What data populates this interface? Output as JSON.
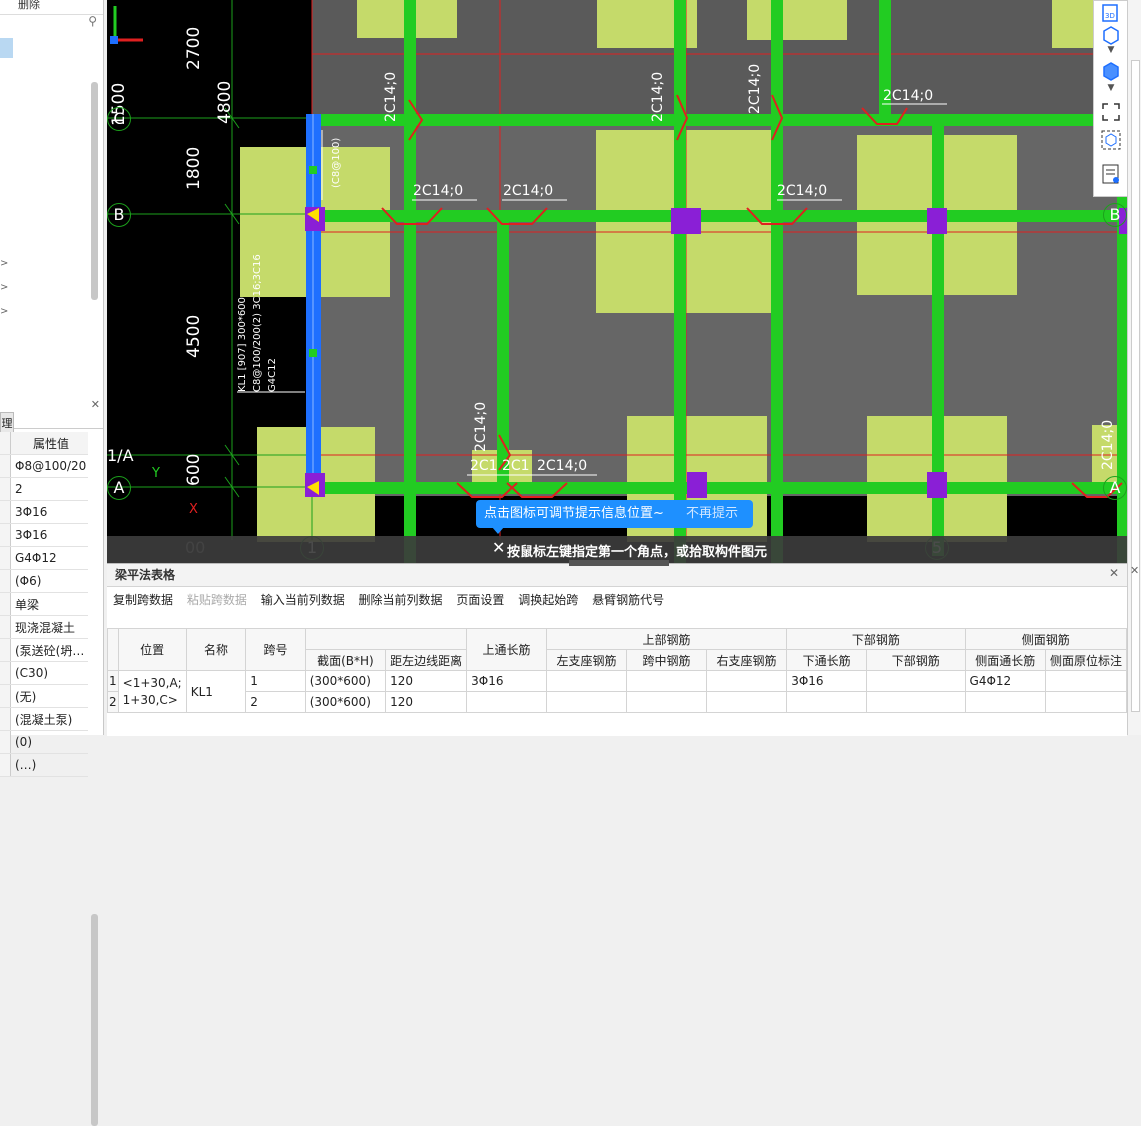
{
  "left_top": {
    "toolbar_label": "删除",
    "search_icon": "search-icon",
    "tree_arrows": [
      ">",
      ">",
      ">"
    ]
  },
  "left_bottom": {
    "tab_label": "理",
    "header": "属性值",
    "values": [
      "Φ8@100/20",
      "2",
      "3Φ16",
      "3Φ16",
      "G4Φ12",
      "(Φ6)",
      "单梁",
      "现浇混凝土",
      "(泵送砼(坍…",
      "(C30)",
      "(无)",
      "(混凝土泵)",
      "(0)",
      "(…)"
    ]
  },
  "canvas": {
    "dimensions": [
      "2700",
      "4800",
      "1500",
      "1800",
      "4500",
      "600"
    ],
    "axes": [
      "C",
      "B",
      "1/A",
      "A",
      "1",
      "5",
      "B",
      "A",
      "00",
      "("
    ],
    "beam_label": "KL1 [907] 300*600",
    "beam_label2": "C8@100/200(2) 3C16;3C16",
    "beam_label3": "G4C12",
    "beam_stirrup": "(C8@100)",
    "rebar_label": "2C14;0",
    "rebar_label_short": "2C1",
    "tip": {
      "message": "点击图标可调节提示信息位置~",
      "dismiss": "不再提示"
    },
    "status": "按鼠标左键指定第一个角点，或拾取构件图元",
    "ucs": {
      "x": "X",
      "y": "Y"
    }
  },
  "right_toolbar": {
    "icons": [
      "3d-view-icon",
      "cube-icon",
      "chevron-down-icon",
      "cube-solid-icon",
      "chevron-down-icon",
      "fit-view-icon",
      "view-cube-icon",
      "report-icon"
    ],
    "label_3d": "3D"
  },
  "bottom": {
    "title": "梁平法表格",
    "toolbar": [
      {
        "label": "复制跨数据",
        "disabled": false
      },
      {
        "label": "粘贴跨数据",
        "disabled": true
      },
      {
        "label": "输入当前列数据",
        "disabled": false
      },
      {
        "label": "删除当前列数据",
        "disabled": false
      },
      {
        "label": "页面设置",
        "disabled": false
      },
      {
        "label": "调换起始跨",
        "disabled": false
      },
      {
        "label": "悬臂钢筋代号",
        "disabled": false
      }
    ],
    "headers": {
      "position": "位置",
      "name": "名称",
      "span": "跨号",
      "section": "截面(B*H)",
      "offset": "距左边线距离",
      "top_through": "上通长筋",
      "top_group": "上部钢筋",
      "left_support": "左支座钢筋",
      "mid_span": "跨中钢筋",
      "right_support": "右支座钢筋",
      "bottom_group": "下部钢筋",
      "bottom_through": "下通长筋",
      "bottom_bar": "下部钢筋",
      "side_group": "侧面钢筋",
      "side_through": "侧面通长筋",
      "side_in_situ": "侧面原位标注"
    },
    "rows": [
      {
        "index": "1",
        "position": "<1+30,A;",
        "name": "KL1",
        "span": "1",
        "section": "(300*600)",
        "offset": "120",
        "top_through": "3Φ16",
        "left_support": "",
        "mid_span": "",
        "right_support": "",
        "bottom_through": "3Φ16",
        "bottom_bar": "",
        "side_through": "G4Φ12",
        "side_in_situ": ""
      },
      {
        "index": "2",
        "position": "1+30,C>",
        "name": "",
        "span": "2",
        "section": "(300*600)",
        "offset": "120",
        "top_through": "",
        "left_support": "",
        "mid_span": "",
        "right_support": "",
        "bottom_through": "",
        "bottom_bar": "",
        "side_through": "",
        "side_in_situ": ""
      }
    ]
  }
}
